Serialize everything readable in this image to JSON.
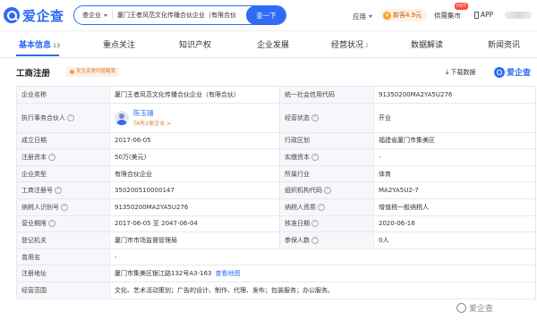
{
  "header": {
    "brand": "爱企查",
    "search": {
      "scope": "查企业",
      "value": "厦门王者风范文化传播合伙企业（有限合伙",
      "button": "查一下"
    },
    "app_menu": "应用",
    "promo": "新客4.9元",
    "promo_icon": "¥",
    "supply": "供需集市",
    "hot": "HOT",
    "app_link": "APP"
  },
  "tabs": [
    {
      "label": "基本信息",
      "count": "13"
    },
    {
      "label": "重点关注",
      "count": ""
    },
    {
      "label": "知识产权",
      "count": ""
    },
    {
      "label": "企业发展",
      "count": ""
    },
    {
      "label": "经营状况",
      "count": "2"
    },
    {
      "label": "数据解读",
      "count": ""
    },
    {
      "label": "新闻资讯",
      "count": ""
    }
  ],
  "section": {
    "title": "工商注册",
    "tag": "发生变更时提醒我",
    "download": "下载数据",
    "download_icon": "⤓",
    "brand": "爱企查"
  },
  "info": {
    "company_name_label": "企业名称",
    "company_name": "厦门王者风范文化传播合伙企业（有限合伙）",
    "credit_code_label": "统一社会信用代码",
    "credit_code": "91350200MA2YA5U276",
    "partner_label": "执行事务合伙人",
    "partner_name": "陈玉珊",
    "partner_sub": "TA有2家企业 >",
    "status_label": "经营状态",
    "status": "开业",
    "founded_label": "成立日期",
    "founded": "2017-06-05",
    "region_label": "行政区划",
    "region": "福建省厦门市集美区",
    "reg_capital_label": "注册资本",
    "reg_capital": "50万(美元)",
    "paid_capital_label": "实缴资本",
    "paid_capital": "-",
    "type_label": "企业类型",
    "type": "有限合伙企业",
    "industry_label": "所属行业",
    "industry": "体育",
    "reg_no_label": "工商注册号",
    "reg_no": "350200510000147",
    "org_code_label": "组织机构代码",
    "org_code": "MA2YA5U2-7",
    "tax_id_label": "纳税人识别号",
    "tax_id": "91350200MA2YA5U276",
    "taxpayer_label": "纳税人资质",
    "taxpayer": "增值税一般纳税人",
    "term_label": "营业期限",
    "term": "2017-06-05 至 2047-06-04",
    "approved_label": "核准日期",
    "approved": "2020-06-16",
    "authority_label": "登记机关",
    "authority": "厦门市市场监督管理局",
    "insured_label": "参保人数",
    "insured": "0人",
    "former_name_label": "曾用名",
    "former_name": "-",
    "address_label": "注册地址",
    "address": "厦门市集美区银江路132号A3-163",
    "map_link": "查看地图",
    "scope_label": "经营范围",
    "scope": "文化、艺术活动策划；广告的设计、制作、代理、发布；包装服务；办公服务。"
  },
  "watermark": "爱企查",
  "icons": {
    "help": "?"
  }
}
